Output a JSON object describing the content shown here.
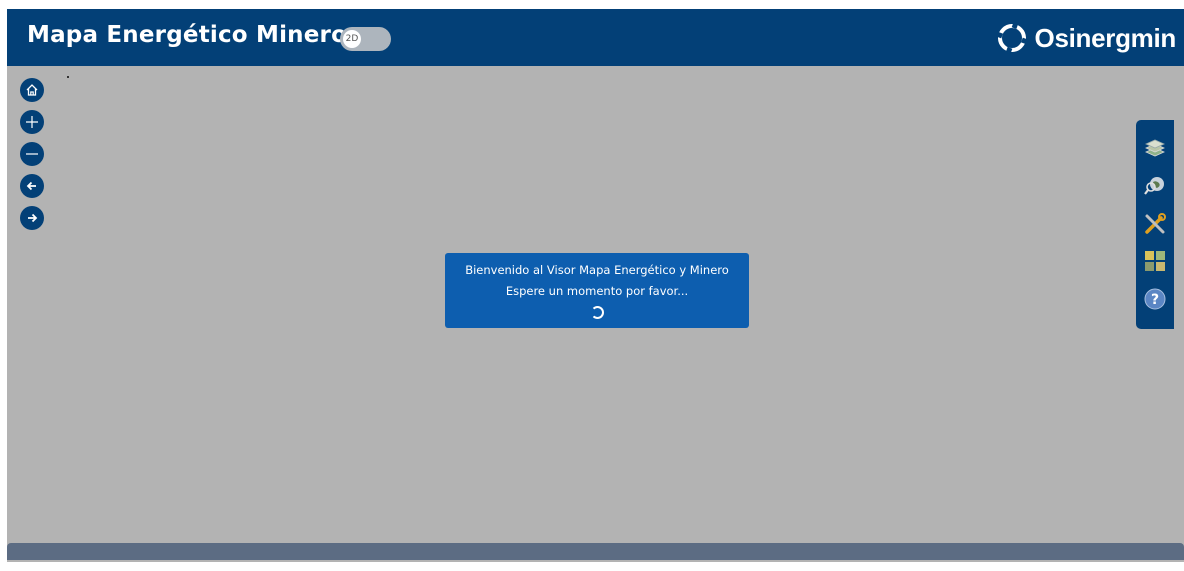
{
  "header": {
    "title": "Mapa Energético Minero",
    "toggle_label": "2D",
    "brand": "Osinergmin"
  },
  "map_controls": [
    {
      "name": "home-button",
      "icon": "home-icon"
    },
    {
      "name": "zoom-in-button",
      "icon": "plus-icon"
    },
    {
      "name": "zoom-out-button",
      "icon": "minus-icon"
    },
    {
      "name": "back-button",
      "icon": "arrow-left-icon"
    },
    {
      "name": "forward-button",
      "icon": "arrow-right-icon"
    }
  ],
  "right_toolbar": [
    {
      "name": "layers-button",
      "icon": "layers-icon"
    },
    {
      "name": "search-map-button",
      "icon": "globe-search-icon"
    },
    {
      "name": "tools-button",
      "icon": "tools-icon"
    },
    {
      "name": "basemap-gallery-button",
      "icon": "basemap-grid-icon"
    },
    {
      "name": "help-button",
      "icon": "help-icon"
    }
  ],
  "loading": {
    "line1": "Bienvenido al Visor Mapa Energético y Minero",
    "line2": "Espere un momento por favor..."
  },
  "colors": {
    "header_bg": "#034077",
    "map_bg": "#b3b3b3",
    "dialog_bg": "#0d5eaf",
    "footer_bar": "#5c6c83"
  }
}
